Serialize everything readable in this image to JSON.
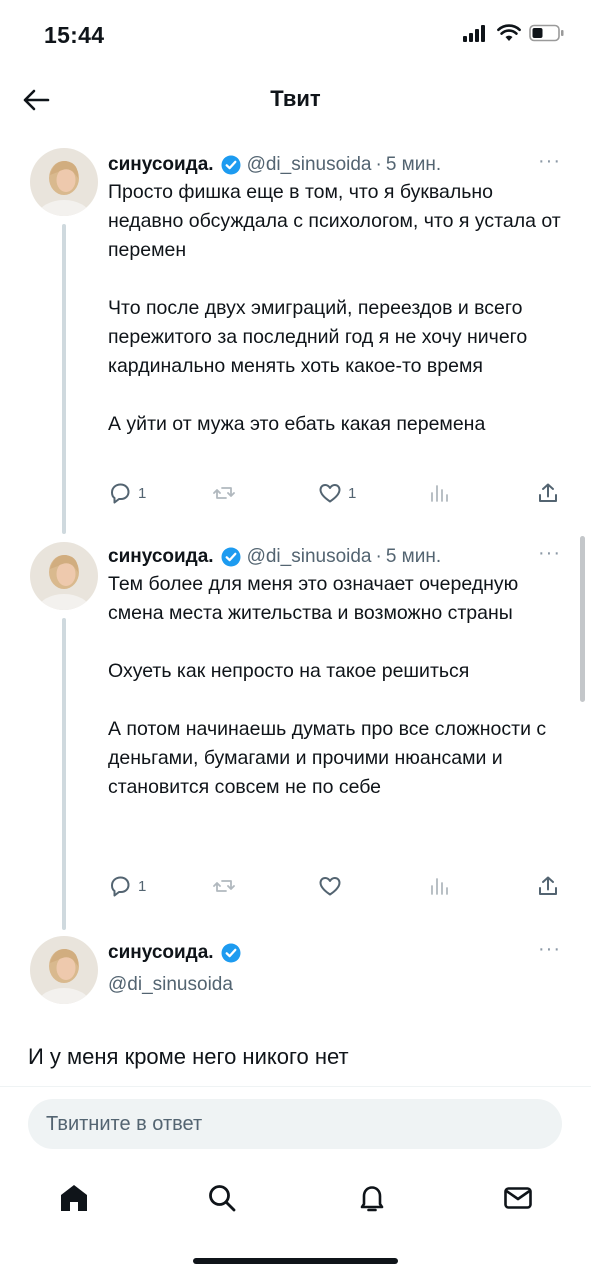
{
  "status": {
    "time": "15:44"
  },
  "header": {
    "title": "Твит"
  },
  "tweets": [
    {
      "name": "синусоида.",
      "handle": "@di_sinusoida",
      "dot": "·",
      "time": "5 мин.",
      "paragraphs": [
        "Просто фишка еще в том, что я буквально недавно обсуждала с психологом, что я устала от перемен",
        "Что после двух эмиграций, переездов и всего пережитого за последний год я не хочу ничего кардинально менять хоть какое-то время",
        "А уйти от мужа это ебать какая перемена"
      ],
      "replies": "1",
      "likes": "1"
    },
    {
      "name": "синусоида.",
      "handle": "@di_sinusoida",
      "dot": "·",
      "time": "5 мин.",
      "paragraphs": [
        "Тем более для меня это означает очередную смена места жительства и возможно страны",
        "Охуеть как непросто на такое решиться",
        "А потом начинаешь думать про все сложности с деньгами, бумагами и прочими нюансами и становится совсем не по себе"
      ],
      "replies": "1"
    },
    {
      "name": "синусоида.",
      "handle": "@di_sinusoida",
      "text": "И у меня кроме него никого нет"
    }
  ],
  "reply": {
    "placeholder": "Твитните в ответ"
  },
  "colors": {
    "accent": "#1d9bf0",
    "text": "#0f1419",
    "muted": "#536471",
    "line": "#cfd9de"
  },
  "icons": {
    "back": "arrow-left-icon",
    "verified": "verified-badge-icon",
    "more": "more-icon",
    "reply": "reply-icon",
    "retweet": "retweet-icon",
    "like": "heart-icon",
    "views": "views-icon",
    "share": "share-icon",
    "home": "home-icon",
    "search": "search-icon",
    "notifications": "bell-icon",
    "messages": "mail-icon"
  }
}
